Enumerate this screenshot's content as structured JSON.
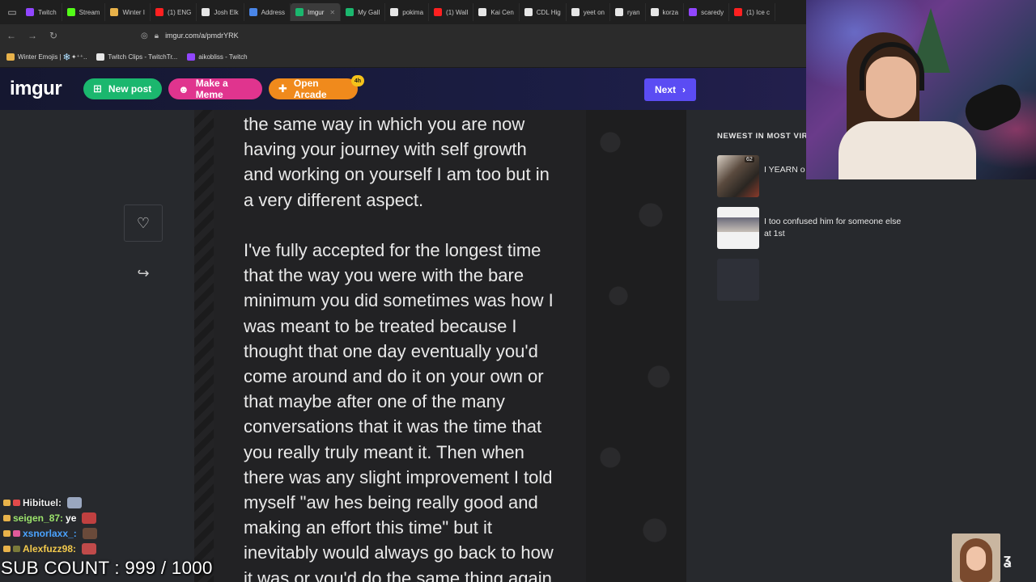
{
  "browser": {
    "tabs": [
      {
        "label": "Twitch",
        "color": "#9146ff"
      },
      {
        "label": "Stream",
        "color": "#53fc18"
      },
      {
        "label": "Winter I",
        "color": "#e8b24a"
      },
      {
        "label": "(1) ENG",
        "color": "#ff2020"
      },
      {
        "label": "Josh Elk",
        "color": "#e6e6e6"
      },
      {
        "label": "Address",
        "color": "#4a86e8"
      },
      {
        "label": "Imgur",
        "color": "#1bb76e",
        "active": true
      },
      {
        "label": "My Gall",
        "color": "#1bb76e"
      },
      {
        "label": "pokima",
        "color": "#e6e6e6"
      },
      {
        "label": "(1) Wall",
        "color": "#ff2020"
      },
      {
        "label": "Kai Cen",
        "color": "#e6e6e6"
      },
      {
        "label": "CDL Hig",
        "color": "#e6e6e6"
      },
      {
        "label": "yeet on",
        "color": "#e6e6e6"
      },
      {
        "label": "ryan",
        "color": "#e6e6e6"
      },
      {
        "label": "korza",
        "color": "#e6e6e6"
      },
      {
        "label": "scaredy",
        "color": "#9146ff"
      },
      {
        "label": "(1) Ice c",
        "color": "#ff2020"
      }
    ],
    "url": "imgur.com/a/pmdrYRK",
    "bookmarks": [
      {
        "label": "Winter Emojis | ❄️✦⁺⁺..",
        "color": "#e8b24a"
      },
      {
        "label": "Twitch Clips - TwitchTr...",
        "color": "#e8e8e8"
      },
      {
        "label": "aikobliss - Twitch",
        "color": "#9146ff"
      }
    ]
  },
  "header": {
    "logo": "imgur",
    "new_post": "New post",
    "make_meme": "Make a Meme",
    "open_arcade": "Open Arcade",
    "arcade_badge": "4h",
    "next": "Next"
  },
  "post": {
    "text": "the same way in which you are now\nhaving your journey with self growth\nand working on yourself I am too but in\na very different aspect.\n\nI've fully accepted for the longest time\nthat the way you were with the bare\nminimum you did sometimes was how I\nwas meant to be treated because I\nthought that one day eventually you'd\ncome around and do it on your own or\nthat maybe after one of the many\nconversations that it was the time that\nyou really truly meant it. Then when\nthere was any slight improvement I told\nmyself \"aw hes being really good and\nmaking an effort this time\" but it\ninevitably would always go back to how\nit was or you'd do the same thing again"
  },
  "sidebar": {
    "title": "NEWEST IN MOST VIRAL",
    "items": [
      {
        "title": "I YEARN o",
        "count": "62"
      },
      {
        "title": "I too confused him for someone else at 1st"
      },
      {
        "title": ""
      }
    ]
  },
  "chat": [
    {
      "user": "Hibituel:",
      "msg": "",
      "color": "#f0f0f0"
    },
    {
      "user": "seigen_87:",
      "msg": "ye",
      "color": "#9be36b"
    },
    {
      "user": "xsnorlaxx_:",
      "msg": "",
      "color": "#4aa3ff"
    },
    {
      "user": "Alexfuzz98:",
      "msg": "",
      "color": "#f2c94c"
    }
  ],
  "overlay": {
    "sub_count": "SUB COUNT : 999 / 1000"
  },
  "colors": {
    "accent_next": "#5b4cf3",
    "new_post": "#1bb76e",
    "make_meme": "#e0348e",
    "open_arcade": "#f08a1c"
  }
}
